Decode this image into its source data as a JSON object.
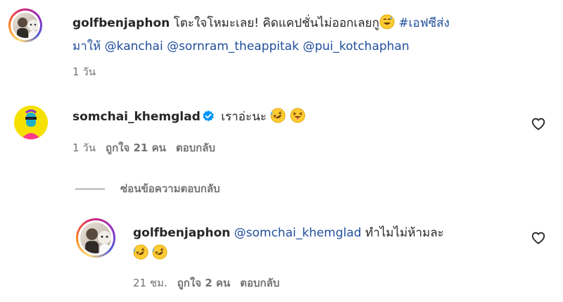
{
  "comments": [
    {
      "username": "golfbenjaphon",
      "text": "โตะใจโหมะเลย! คิดแคปชั่นไม่ออกเลยกู",
      "hashtag": "#เอฟซีส่ง",
      "text_line2": "มาให้",
      "mentions": [
        "@kanchai",
        "@sornram_theappitak",
        "@pui_kotchaphan"
      ],
      "time": "1 วัน"
    },
    {
      "username": "somchai_khemglad",
      "verified": true,
      "text": "เราอ่ะนะ",
      "time": "1 วัน",
      "likes": "ถูกใจ 21 คน",
      "reply_label": "ตอบกลับ"
    }
  ],
  "replies_toggle": "ซ่อนข้อความตอบกลับ",
  "reply": {
    "username": "golfbenjaphon",
    "mention": "@somchai_khemglad",
    "text": "ทำไมไม่ห้ามละ",
    "time": "21 ชม.",
    "likes": "ถูกใจ 2 คน",
    "reply_label": "ตอบกลับ"
  },
  "icons": {
    "heart": "heart-outline-icon",
    "verified": "verified-badge-icon",
    "emoji_rofl": "rolling-on-floor-laughing-emoji",
    "emoji_tongue": "squinting-face-with-tongue-emoji",
    "emoji_sweat": "grinning-face-with-sweat-emoji"
  },
  "colors": {
    "mention": "#1f4e9c",
    "verified": "#0095f6",
    "meta": "#737373",
    "text": "#262626"
  }
}
